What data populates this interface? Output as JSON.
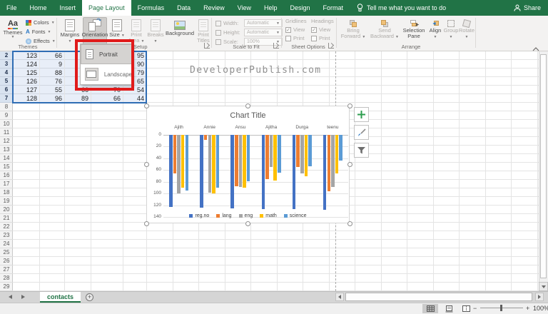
{
  "app": {
    "tabs": [
      "File",
      "Home",
      "Insert",
      "Page Layout",
      "Formulas",
      "Data",
      "Review",
      "View",
      "Help",
      "Design",
      "Format"
    ],
    "active_tab": "Page Layout",
    "tell_me_label": "Tell me what you want to do",
    "share_label": "Share"
  },
  "ribbon": {
    "themes": {
      "group_label": "Themes",
      "main_button": "Themes",
      "small_buttons": [
        "Colors",
        "Fonts",
        "Effects"
      ]
    },
    "page_setup": {
      "group_label": "Page Setup",
      "buttons": [
        {
          "label": "Margins",
          "caret": true,
          "enabled": true,
          "pressed": false
        },
        {
          "label": "Orientation",
          "caret": true,
          "enabled": true,
          "pressed": true
        },
        {
          "label": "Size",
          "caret": true,
          "enabled": true,
          "pressed": false
        },
        {
          "label": "Print Area",
          "caret": true,
          "enabled": false,
          "pressed": false
        },
        {
          "label": "Breaks",
          "caret": true,
          "enabled": false,
          "pressed": false
        },
        {
          "label": "Background",
          "caret": false,
          "enabled": true,
          "pressed": false
        },
        {
          "label": "Print Titles",
          "caret": false,
          "enabled": false,
          "pressed": false
        }
      ]
    },
    "scale_to_fit": {
      "group_label": "Scale to Fit",
      "fields": [
        {
          "label": "Width:",
          "value": "Automatic"
        },
        {
          "label": "Height:",
          "value": "Automatic"
        },
        {
          "label": "Scale:",
          "value": "100%"
        }
      ]
    },
    "sheet_options": {
      "group_label": "Sheet Options",
      "columns": [
        {
          "header": "Gridlines",
          "view_label": "View",
          "view_checked": true,
          "print_label": "Print",
          "print_checked": false
        },
        {
          "header": "Headings",
          "view_label": "View",
          "view_checked": true,
          "print_label": "Print",
          "print_checked": false
        }
      ]
    },
    "arrange": {
      "group_label": "Arrange",
      "buttons": [
        {
          "label": "Bring Forward",
          "caret": true,
          "enabled": false
        },
        {
          "label": "Send Backward",
          "caret": true,
          "enabled": false
        },
        {
          "label": "Selection Pane",
          "caret": false,
          "enabled": true
        },
        {
          "label": "Align",
          "caret": true,
          "enabled": true
        },
        {
          "label": "Group",
          "caret": true,
          "enabled": false
        },
        {
          "label": "Rotate",
          "caret": true,
          "enabled": false
        }
      ]
    }
  },
  "orientation_dropdown": {
    "items": [
      {
        "label": "Portrait",
        "highlighted": true
      },
      {
        "label": "Landscape",
        "highlighted": false
      }
    ]
  },
  "annotation": {
    "color": "#e01a1a"
  },
  "watermark": "DeveloperPublish.com",
  "grid": {
    "row_numbers": [
      2,
      3,
      4,
      5,
      6,
      7,
      8,
      9,
      10,
      11,
      12,
      13,
      14,
      15,
      16,
      17,
      18,
      19,
      20,
      21,
      22,
      23,
      24,
      25,
      26,
      27,
      28,
      29
    ],
    "selected_rows": [
      2,
      3,
      4,
      5,
      6,
      7
    ],
    "data_rows": [
      {
        "row": 2,
        "cells": [
          "123",
          "66",
          "",
          "",
          "95"
        ]
      },
      {
        "row": 3,
        "cells": [
          "124",
          "9",
          "",
          "",
          "90"
        ]
      },
      {
        "row": 4,
        "cells": [
          "125",
          "88",
          "",
          "",
          "79"
        ]
      },
      {
        "row": 5,
        "cells": [
          "126",
          "76",
          "",
          "",
          "65"
        ]
      },
      {
        "row": 6,
        "cells": [
          "127",
          "55",
          "66",
          "70",
          "54"
        ]
      },
      {
        "row": 7,
        "cells": [
          "128",
          "96",
          "89",
          "66",
          "44"
        ]
      }
    ]
  },
  "chart_data": {
    "type": "bar",
    "title": "Chart Title",
    "categories": [
      "Ajith",
      "Annie",
      "Ansu",
      "Ajitha",
      "Durga",
      "teenu"
    ],
    "series": [
      {
        "name": "reg.no",
        "color": "#4472C4",
        "values": [
          123,
          124,
          125,
          126,
          127,
          128
        ]
      },
      {
        "name": "lang",
        "color": "#ED7D31",
        "values": [
          66,
          9,
          88,
          76,
          55,
          96
        ]
      },
      {
        "name": "eng",
        "color": "#A5A5A5",
        "values": [
          100,
          98,
          89,
          55,
          66,
          89
        ]
      },
      {
        "name": "math",
        "color": "#FFC000",
        "values": [
          90,
          100,
          90,
          78,
          70,
          66
        ]
      },
      {
        "name": "science",
        "color": "#5B9BD5",
        "values": [
          95,
          90,
          79,
          65,
          54,
          44
        ]
      }
    ],
    "value_axis": {
      "ticks": [
        0,
        20,
        40,
        60,
        80,
        100,
        120,
        140
      ],
      "max": 140,
      "reversed": true
    },
    "grid": true,
    "legend_position": "bottom"
  },
  "chart_tools": {
    "buttons": [
      "chart-elements-plus-icon",
      "chart-styles-brush-icon",
      "chart-filters-funnel-icon"
    ],
    "plus_color": "#2E9E4F"
  },
  "sheet_bar": {
    "active_sheet": "contacts"
  },
  "status_bar": {
    "zoom_level": "100%"
  },
  "colors": {
    "brand_green": "#217346",
    "selection_blue": "#2f6db4",
    "annotation_red": "#e01a1a"
  }
}
